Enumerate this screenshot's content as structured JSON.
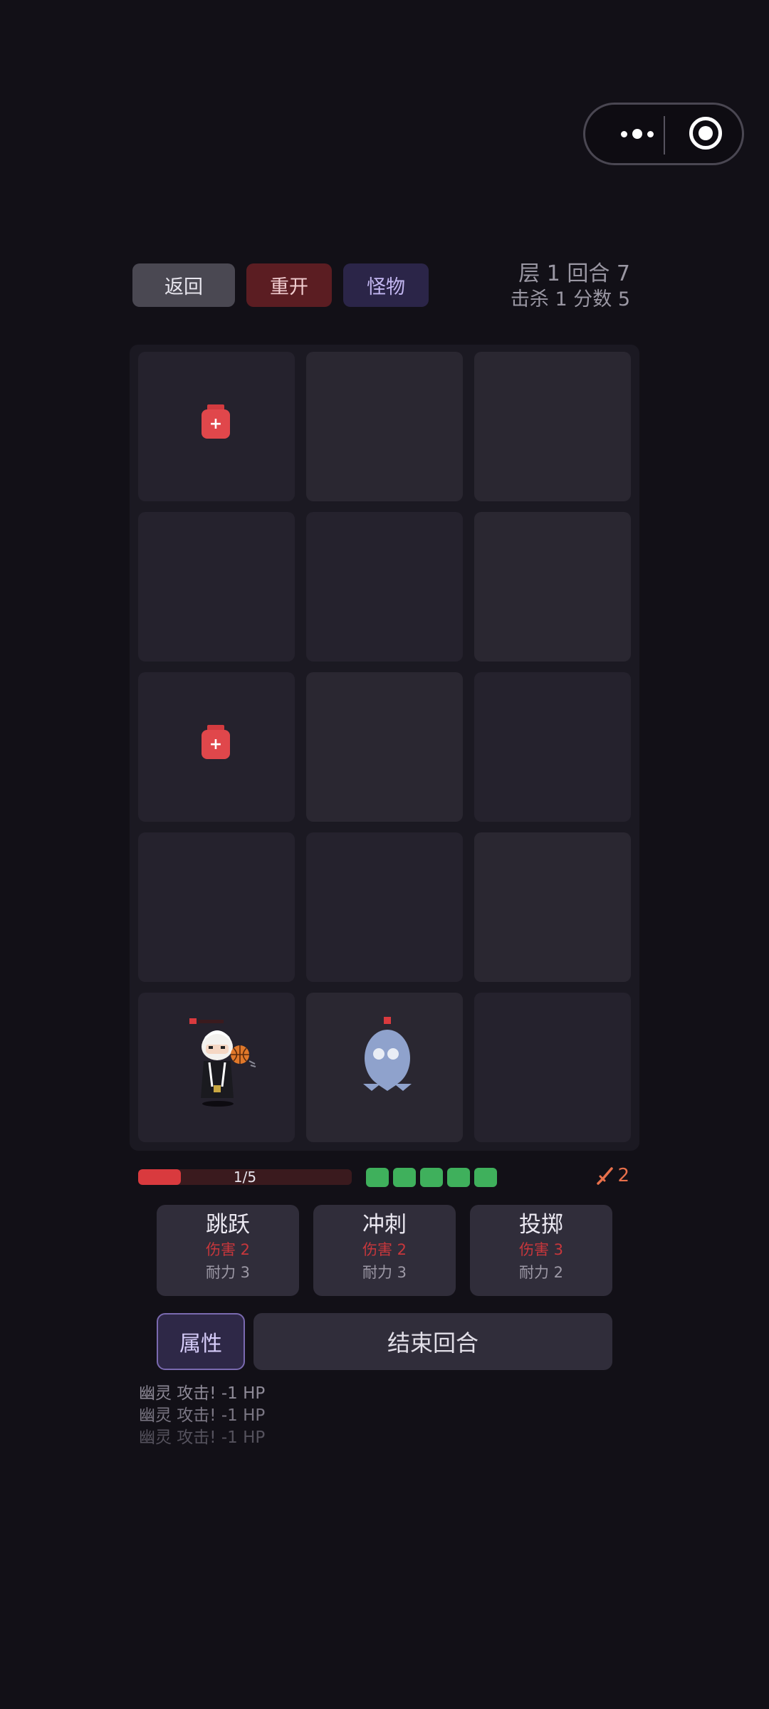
{
  "top_buttons": {
    "back": "返回",
    "restart": "重开",
    "monster": "怪物"
  },
  "stats": {
    "line1": "层 1  回合 7",
    "line2": "击杀 1  分数 5"
  },
  "board": {
    "rows": 5,
    "cols": 3,
    "potions": [
      {
        "row": 0,
        "col": 0,
        "symbol": "+"
      },
      {
        "row": 2,
        "col": 0,
        "symbol": "+"
      }
    ],
    "player": {
      "row": 4,
      "col": 0
    },
    "enemy": {
      "row": 4,
      "col": 1,
      "name": "幽灵"
    }
  },
  "hp": {
    "current": 1,
    "max": 5,
    "text": "1/5",
    "fill_fraction": 0.2
  },
  "energy": {
    "count": 5
  },
  "attack": {
    "value": "2"
  },
  "skills": [
    {
      "name": "跳跃",
      "damage": "伤害 2",
      "stamina": "耐力 3"
    },
    {
      "name": "冲刺",
      "damage": "伤害 2",
      "stamina": "耐力 3"
    },
    {
      "name": "投掷",
      "damage": "伤害 3",
      "stamina": "耐力 2"
    }
  ],
  "actions": {
    "attributes": "属性",
    "end_turn": "结束回合"
  },
  "log": [
    "幽灵 攻击! -1 HP",
    "幽灵 攻击! -1 HP",
    "幽灵 攻击! -1 HP"
  ],
  "colors": {
    "hp": "#d93a3e",
    "energy": "#3fb05c",
    "damage": "#c8373c",
    "attack": "#e8704b"
  }
}
